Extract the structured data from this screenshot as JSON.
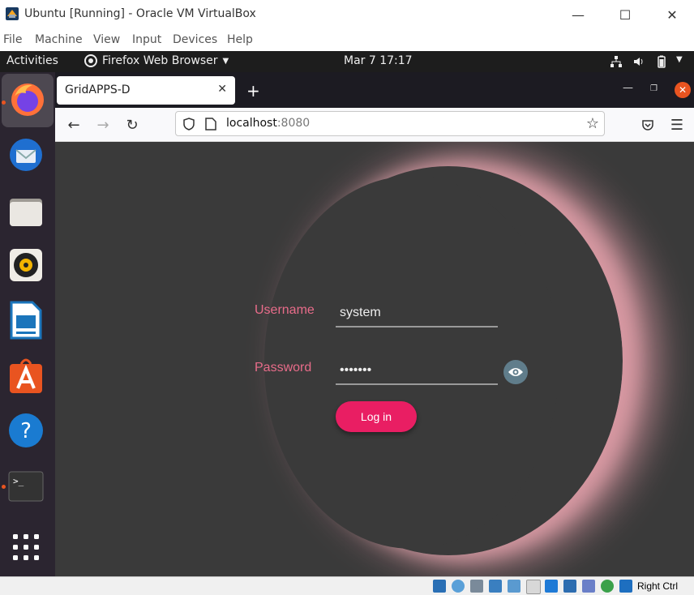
{
  "window": {
    "title": "Ubuntu [Running] - Oracle VM VirtualBox",
    "controls": {
      "minimize": "—",
      "maximize": "☐",
      "close": "✕"
    }
  },
  "vb_menu": [
    "File",
    "Machine",
    "View",
    "Input",
    "Devices",
    "Help"
  ],
  "gnome_topbar": {
    "activities": "Activities",
    "app_menu": "Firefox Web Browser",
    "datetime": "Mar 7  17:17"
  },
  "dock": {
    "apps": [
      "firefox-icon",
      "thunderbird-icon",
      "files-icon",
      "rhythmbox-icon",
      "libreoffice-writer-icon",
      "ubuntu-software-icon",
      "help-icon",
      "terminal-icon",
      "show-apps-icon"
    ]
  },
  "browser": {
    "tab_title": "GridAPPS-D",
    "url_host": "localhost",
    "url_port": ":8080"
  },
  "login": {
    "username_label": "Username",
    "username_value": "system",
    "password_label": "Password",
    "password_value": "•••••••",
    "login_button": "Log in"
  },
  "statusbar": {
    "host_key": "Right Ctrl"
  },
  "colors": {
    "accent": "#e91e63",
    "label_pink": "#e86c8a",
    "ubuntu_orange": "#e95420",
    "page_bg": "#3a3a3a"
  }
}
